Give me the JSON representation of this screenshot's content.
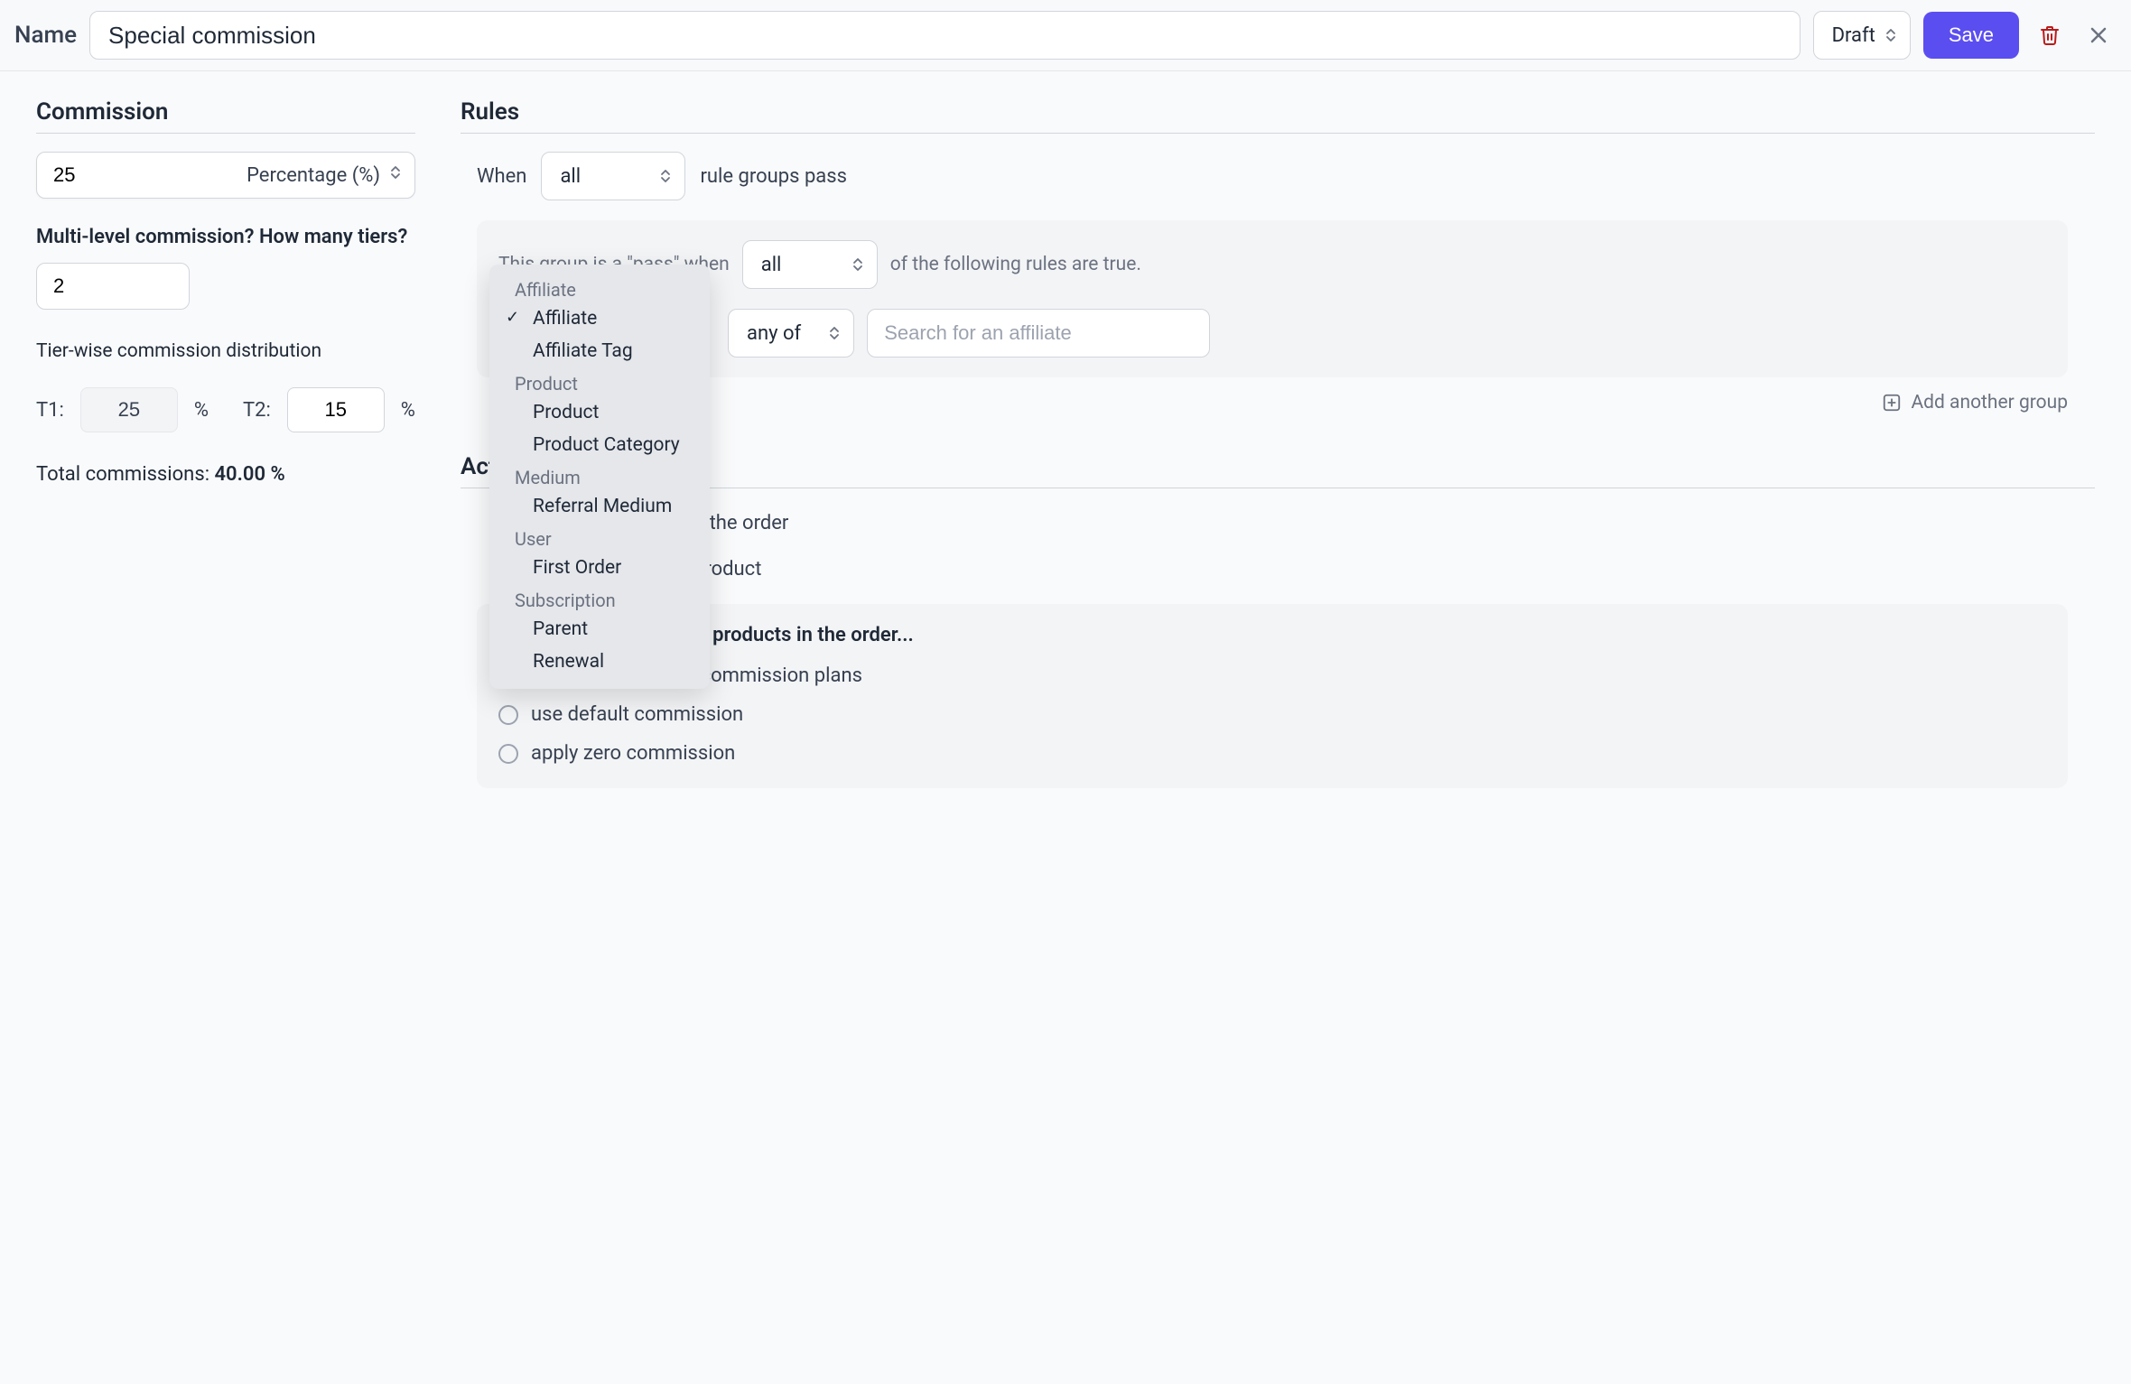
{
  "header": {
    "name_label": "Name",
    "name_value": "Special commission",
    "status": "Draft",
    "save_label": "Save"
  },
  "commission": {
    "heading": "Commission",
    "value": "25",
    "type_label": "Percentage (%)",
    "multilevel_label": "Multi-level commission? How many tiers?",
    "tier_count": "2",
    "distribution_label": "Tier-wise commission distribution",
    "tiers": {
      "t1_label": "T1:",
      "t1_value": "25",
      "t2_label": "T2:",
      "t2_value": "15",
      "pct": "%"
    },
    "total_label": "Total commissions: ",
    "total_value": "40.00 %"
  },
  "rules": {
    "heading": "Rules",
    "when_prefix": "When",
    "when_value": "all",
    "when_suffix": "rule groups pass",
    "group_prefix": "This group is a \"pass\" when",
    "group_match": "all",
    "group_suffix": "of the following rules are true.",
    "rule_condition": "any of",
    "search_placeholder": "Search for an affiliate",
    "add_group_label": "Add another group"
  },
  "dropdown": {
    "groups": [
      {
        "label": "Affiliate",
        "items": [
          {
            "label": "Affiliate",
            "checked": true
          },
          {
            "label": "Affiliate Tag",
            "checked": false
          }
        ]
      },
      {
        "label": "Product",
        "items": [
          {
            "label": "Product",
            "checked": false
          },
          {
            "label": "Product Category",
            "checked": false
          }
        ]
      },
      {
        "label": "Medium",
        "items": [
          {
            "label": "Referral Medium",
            "checked": false
          }
        ]
      },
      {
        "label": "User",
        "items": [
          {
            "label": "First Order",
            "checked": false
          }
        ]
      },
      {
        "label": "Subscription",
        "items": [
          {
            "label": "Parent",
            "checked": false
          },
          {
            "label": "Renewal",
            "checked": false
          }
        ]
      }
    ]
  },
  "actions": {
    "heading": "Actions",
    "hidden_line_1_suffix": "n the order",
    "hidden_line_2_suffix": "product",
    "remaining_title": "And then, for remaining products in the order...",
    "options": [
      {
        "label": "continue matching commission plans",
        "selected": true
      },
      {
        "label": "use default commission",
        "selected": false
      },
      {
        "label": "apply zero commission",
        "selected": false
      }
    ]
  }
}
